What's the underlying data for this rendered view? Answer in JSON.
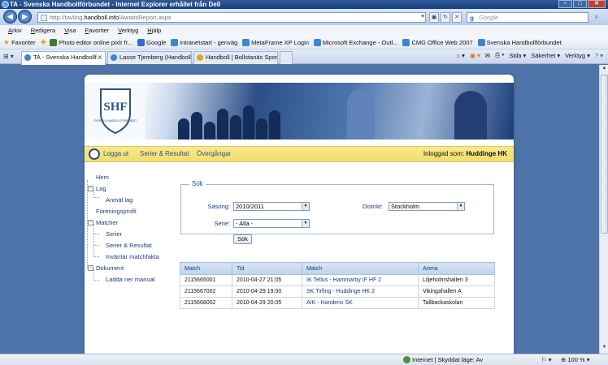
{
  "browser": {
    "title": "TA - Svenska Handbollförbundet - Internet Explorer erhållet från Dell",
    "url_prefix": "http://tavling.",
    "url_domain": "handboll.info",
    "url_path": "/AwaitsReport.aspx",
    "search_placeholder": "Google",
    "menu": [
      "Arkiv",
      "Redigera",
      "Visa",
      "Favoriter",
      "Verktyg",
      "Hjälp"
    ],
    "favorites_label": "Favoriter",
    "favorites": [
      {
        "label": "Photo editor online pixlr fr...",
        "icon": "pencil-icon",
        "color": "#3a7d2c"
      },
      {
        "label": "Google",
        "icon": "google-icon",
        "color": "#3367d6"
      },
      {
        "label": "intranetstart - genväg",
        "icon": "ie-icon",
        "color": "#3f86d2"
      },
      {
        "label": "MetaFrame XP Login",
        "icon": "ie-icon",
        "color": "#3f86d2"
      },
      {
        "label": "Microsoft Exchange - Outl...",
        "icon": "ie-icon",
        "color": "#3f86d2"
      },
      {
        "label": "CMG Office Web 2007",
        "icon": "ie-icon",
        "color": "#3f86d2"
      },
      {
        "label": "Svenska Handbollförbundet",
        "icon": "ie-icon",
        "color": "#3f86d2"
      }
    ],
    "tabs": [
      {
        "label": "TA - Svenska Handbollf...",
        "active": true
      },
      {
        "label": "Lasse Tjemberg (Handboll...",
        "active": false
      },
      {
        "label": "Handboll | Bollstanäs Spor...",
        "active": false
      }
    ],
    "commands": [
      "Sida ▾",
      "Säkerhet ▾",
      "Verktyg ▾"
    ],
    "status_zone": "Internet | Skyddat läge: Av",
    "zoom": "100 %"
  },
  "site": {
    "logo_letters": "SHF",
    "logo_caption": "SVENSKA HANDBOLLFÖRBUNDET",
    "nav": [
      "Logga ut",
      "Serier & Resultat",
      "Övergångar"
    ],
    "logged_in_label": "Inloggad som:",
    "logged_in_user": "Huddinge HK"
  },
  "sidebar": {
    "items": [
      {
        "label": "Hem",
        "level": 0,
        "toggle": ""
      },
      {
        "label": "Lag",
        "level": 0,
        "toggle": "−"
      },
      {
        "label": "Anmäl lag",
        "level": 1,
        "toggle": ""
      },
      {
        "label": "Föreningsprofil",
        "level": 0,
        "toggle": ""
      },
      {
        "label": "Matcher",
        "level": 0,
        "toggle": "−"
      },
      {
        "label": "Serier",
        "level": 1,
        "toggle": ""
      },
      {
        "label": "Serier & Resultat",
        "level": 1,
        "toggle": ""
      },
      {
        "label": "Inväntar matchfakta",
        "level": 1,
        "toggle": ""
      },
      {
        "label": "Dokument",
        "level": 0,
        "toggle": "−"
      },
      {
        "label": "Ladda ner manual",
        "level": 1,
        "toggle": ""
      }
    ]
  },
  "search": {
    "legend": "Sök",
    "season_label": "Säsong:",
    "season_value": "2010/2011",
    "district_label": "Distrikt:",
    "district_value": "Stockholm",
    "series_label": "Serie:",
    "series_value": "- Alla -",
    "button": "Sök"
  },
  "results": {
    "columns": [
      "Match",
      "Tid",
      "Match",
      "Arena"
    ],
    "rows": [
      [
        "2115665001",
        "2010-04-27 21:05",
        "IK Tellus - Hammarby IF HF 2",
        "Liljeholmshallen 3"
      ],
      [
        "2115667002",
        "2010-04-29 19:00",
        "SK Tirfing - Huddinge HK 2",
        "Vikingahallen A"
      ],
      [
        "2115668002",
        "2010-04-29 20:05",
        "AIK - Handens SK",
        "Tallbackaskolan"
      ]
    ]
  }
}
